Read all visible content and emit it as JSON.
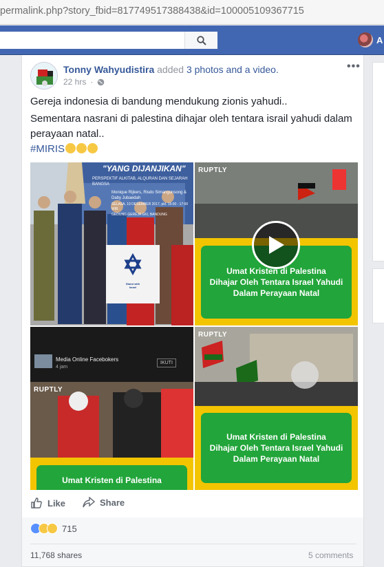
{
  "browser": {
    "url": "permalink.php?story_fbid=817749517388438&id=100005109367715"
  },
  "topbar": {
    "profile_initial": "A"
  },
  "post": {
    "author": "Tonny Wahyudistira",
    "action_pre": "added",
    "action_link": "3 photos and a video.",
    "time": "22 hrs",
    "line1": "Gereja indonesia di bandung mendukung zionis yahudi..",
    "line2": "Sementara nasrani di palestina dihajar oleh tentara israil yahudi dalam perayaan natal..",
    "hashtag": "#MIRIS",
    "media": {
      "photo1_banner": "\"YANG DIJANJIKAN\"",
      "photo1_sub": "PERSPEKTIF ALKITAB, ALQURAN DAN SEJARAH BANGSA",
      "photo1_speakers": "Monique Rijkers, Risdo Simangunsong & Daby Jubaedah",
      "photo1_date": "SELASA, 19 DESEMBER 2017, pkl. 15:00 - 17:00 WIB",
      "photo1_venue": "GEDUNG GEREJA GKI, BANDUNG",
      "shirt_text": "Stand with Israel",
      "ruptly": "RUPTLY",
      "caption_line1": "Umat Kristen di Palestina",
      "caption_line2": "Dihajar Oleh Tentara Israel Yahudi",
      "caption_line3": "Dalam Perayaan Natal",
      "caption_partial": "Umat Kristen di Palestina",
      "fb_label": "Media Online Facebokers",
      "fb_sub": "4 jam",
      "fb_follow": "IKUTI"
    },
    "actions": {
      "like": "Like",
      "share": "Share"
    },
    "stats": {
      "reaction_count": "715",
      "shares": "11,768 shares",
      "comments": "5 comments"
    }
  },
  "colors": {
    "fb_blue": "#4267b2",
    "link": "#365899",
    "green": "#22a53a",
    "yellow": "#f3c400"
  }
}
